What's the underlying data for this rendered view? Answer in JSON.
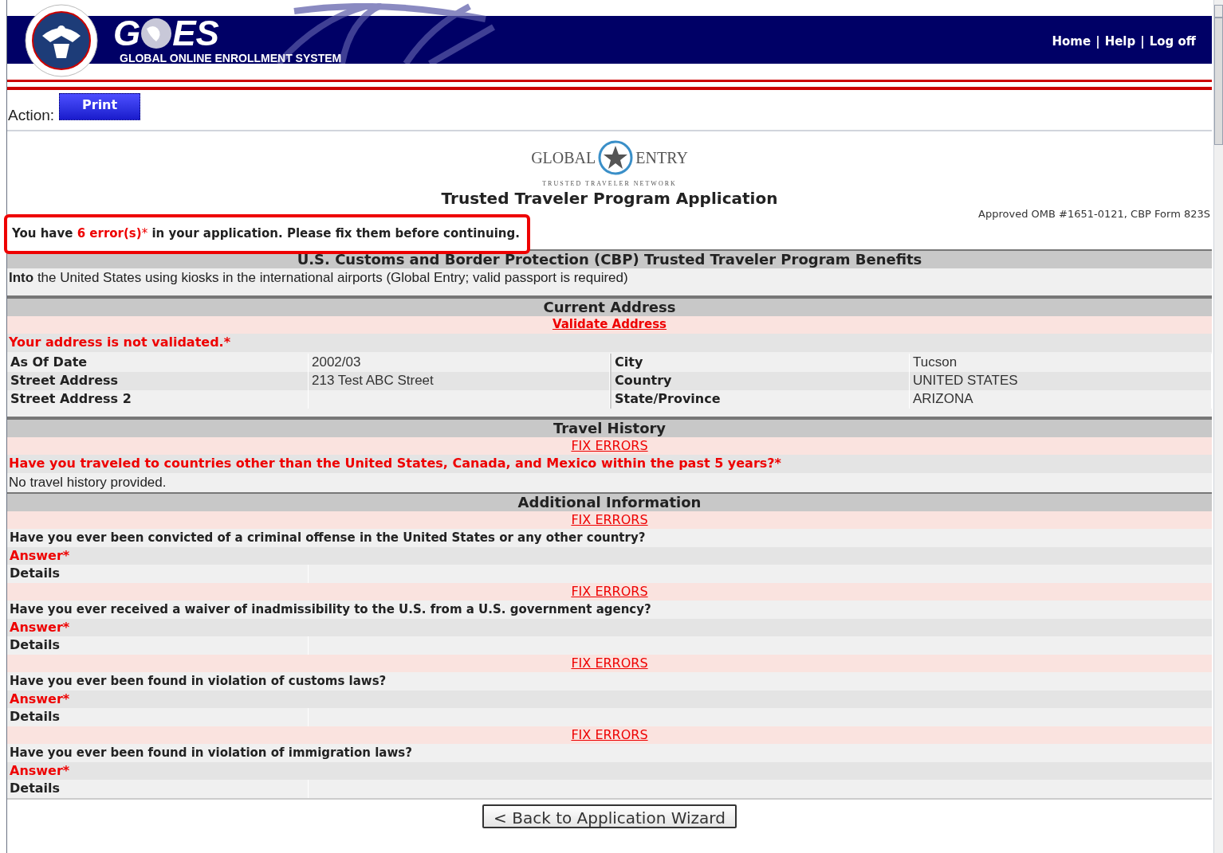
{
  "header": {
    "logo_letters": [
      "G",
      "ES"
    ],
    "logo_subtitle": "GLOBAL ONLINE ENROLLMENT SYSTEM",
    "links": [
      "Home",
      "Help",
      "Log off"
    ],
    "separator": "|"
  },
  "action": {
    "label": "Action:",
    "button": "Print"
  },
  "brand": {
    "left": "GLOBAL",
    "right": "ENTRY",
    "tagline": "TRUSTED TRAVELER NETWORK"
  },
  "title": "Trusted Traveler Program Application",
  "omb": "Approved OMB #1651-0121, CBP Form 823S",
  "error_banner": {
    "before": "You have ",
    "count": "6 error(s)",
    "mark": "*",
    "after": " in your application. Please fix them before continuing."
  },
  "sections": [
    {
      "heading": "U.S. Customs and Border Protection (CBP) Trusted Traveler Program Benefits",
      "rows": [
        {
          "kind": "text",
          "text": "**Into** the United States using kiosks in the international airports (Global Entry; valid passport is required)"
        },
        {
          "kind": "spacer"
        }
      ]
    },
    {
      "heading": "Current Address",
      "rows": [
        {
          "kind": "link",
          "text": "Validate Address",
          "bold": true
        },
        {
          "kind": "error",
          "text": "Your address is not validated.*"
        },
        {
          "kind": "grid",
          "cells": [
            [
              "As Of Date",
              "2002/03",
              "City",
              "Tucson"
            ],
            [
              "Street Address",
              "213 Test ABC Street",
              "Country",
              "UNITED STATES"
            ],
            [
              "Street Address 2",
              "",
              "State/Province",
              "ARIZONA"
            ]
          ]
        },
        {
          "kind": "spacer"
        }
      ]
    },
    {
      "heading": "Travel History",
      "rows": [
        {
          "kind": "link",
          "text": "FIX ERRORS",
          "bold": false
        },
        {
          "kind": "error",
          "text": "Have you traveled to countries other than the United States, Canada, and Mexico within the past 5 years?*"
        },
        {
          "kind": "text",
          "text": "No travel history provided."
        }
      ]
    },
    {
      "heading": "Additional Information",
      "rows": [
        {
          "kind": "link",
          "text": "FIX ERRORS",
          "bold": false
        },
        {
          "kind": "question",
          "text": "Have you ever been convicted of a criminal offense in the United States or any other country?"
        },
        {
          "kind": "answer",
          "text": "Answer*"
        },
        {
          "kind": "pair",
          "label": "Details"
        },
        {
          "kind": "link",
          "text": "FIX ERRORS",
          "bold": false
        },
        {
          "kind": "question",
          "text": "Have you ever received a waiver of inadmissibility to the U.S. from a U.S. government agency?"
        },
        {
          "kind": "answer",
          "text": "Answer*"
        },
        {
          "kind": "pair",
          "label": "Details"
        },
        {
          "kind": "link",
          "text": "FIX ERRORS",
          "bold": false
        },
        {
          "kind": "question",
          "text": "Have you ever been found in violation of customs laws?"
        },
        {
          "kind": "answer",
          "text": "Answer*"
        },
        {
          "kind": "pair",
          "label": "Details"
        },
        {
          "kind": "link",
          "text": "FIX ERRORS",
          "bold": false
        },
        {
          "kind": "question",
          "text": "Have you ever been found in violation of immigration laws?"
        },
        {
          "kind": "answer",
          "text": "Answer*"
        },
        {
          "kind": "pair",
          "label": "Details"
        }
      ]
    }
  ],
  "back_button": "< Back to Application Wizard"
}
